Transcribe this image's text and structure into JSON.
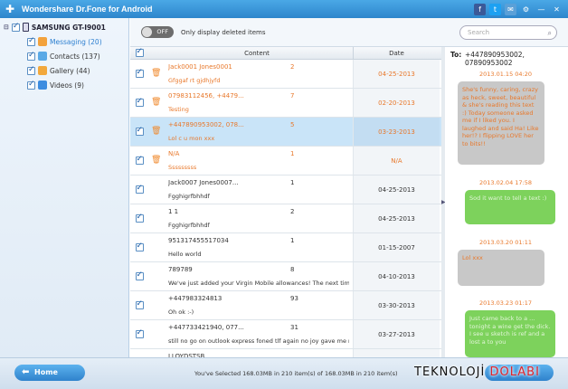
{
  "app": {
    "title": "Wondershare Dr.Fone for Android"
  },
  "sidebar": {
    "device": "SAMSUNG GT-I9001",
    "items": [
      {
        "label": "Messaging (20)",
        "icon": "chat-bubble-icon",
        "color": "#f3a23c"
      },
      {
        "label": "Contacts (137)",
        "icon": "contacts-icon",
        "color": "#5aa9e6"
      },
      {
        "label": "Gallery (44)",
        "icon": "gallery-icon",
        "color": "#f2a83c"
      },
      {
        "label": "Videos (9)",
        "icon": "video-icon",
        "color": "#3c8ce0"
      }
    ]
  },
  "toolbar": {
    "toggle_label": "OFF",
    "toggle_text": "Only display deleted items"
  },
  "search": {
    "placeholder": "Search"
  },
  "table": {
    "headers": {
      "content": "Content",
      "date": "Date"
    },
    "rows": [
      {
        "name": "Jack0001  Jones0001",
        "count": "2",
        "msg": "Gfggaf rt gjdhjyfd",
        "date": "04-25-2013",
        "unread": true,
        "selected": false
      },
      {
        "name": "07983112456, +4479...",
        "count": "7",
        "msg": "Testing",
        "date": "02-20-2013",
        "unread": true,
        "selected": false
      },
      {
        "name": "+447890953002, 078...",
        "count": "5",
        "msg": "Lol c u mon xxx",
        "date": "03-23-2013",
        "unread": true,
        "selected": true
      },
      {
        "name": "N/A",
        "count": "1",
        "msg": "Sssssssss",
        "date": "N/A",
        "unread": true,
        "selected": false
      },
      {
        "name": "Jack0007  Jones0007...",
        "count": "1",
        "msg": "Fgghigrfbhhdf",
        "date": "04-25-2013",
        "unread": false,
        "selected": false
      },
      {
        "name": "1 1",
        "count": "2",
        "msg": "Fgghigrfbhhdf",
        "date": "04-25-2013",
        "unread": false,
        "selected": false
      },
      {
        "name": "951317455517034",
        "count": "1",
        "msg": "Hello world",
        "date": "01-15-2007",
        "unread": false,
        "selected": false
      },
      {
        "name": "789789",
        "count": "8",
        "msg": "We've just added your Virgin Mobile allowances! The next tim...",
        "date": "04-10-2013",
        "unread": false,
        "selected": false
      },
      {
        "name": "+447983324813",
        "count": "93",
        "msg": "Oh ok :-)",
        "date": "03-30-2013",
        "unread": false,
        "selected": false
      },
      {
        "name": "+447733421940, 077...",
        "count": "31",
        "msg": "still no go on outlook express foned tlf again no joy gave me mi...",
        "date": "03-27-2013",
        "unread": false,
        "selected": false
      },
      {
        "name": "LLOYDSTSB",
        "count": "",
        "msg": "",
        "date": "",
        "unread": false,
        "selected": false
      }
    ]
  },
  "conversation": {
    "to_label": "To:",
    "to_value": "+447890953002, 07890953002",
    "messages": [
      {
        "time": "2013.01.15 04:20",
        "text": "She's funny, caring, crazy as heck, sweet, beautiful & she's reading this text :) Today someone asked me if I liked you. I laughed and said Ha! Like her!? I flipping LOVE her to bits!!",
        "side": "in"
      },
      {
        "time": "2013.02.04 17:58",
        "text": "Sod it want to tell a text :)",
        "side": "out"
      },
      {
        "time": "2013.03.20 01:11",
        "text": "Lol xxx",
        "side": "in"
      },
      {
        "time": "2013.03.23 01:17",
        "text": "Just came back to a ... tonight a wine get the dick. I see u sketch is ref and a lost a to you",
        "side": "out"
      }
    ]
  },
  "footer": {
    "home_label": "Home",
    "status": "You've Selected 168.03MB in 210 item(s) of 168.03MB in 210 item(s)"
  },
  "watermark": {
    "part1": "TEKNOLOJİ",
    "part2": "DOLABI"
  }
}
